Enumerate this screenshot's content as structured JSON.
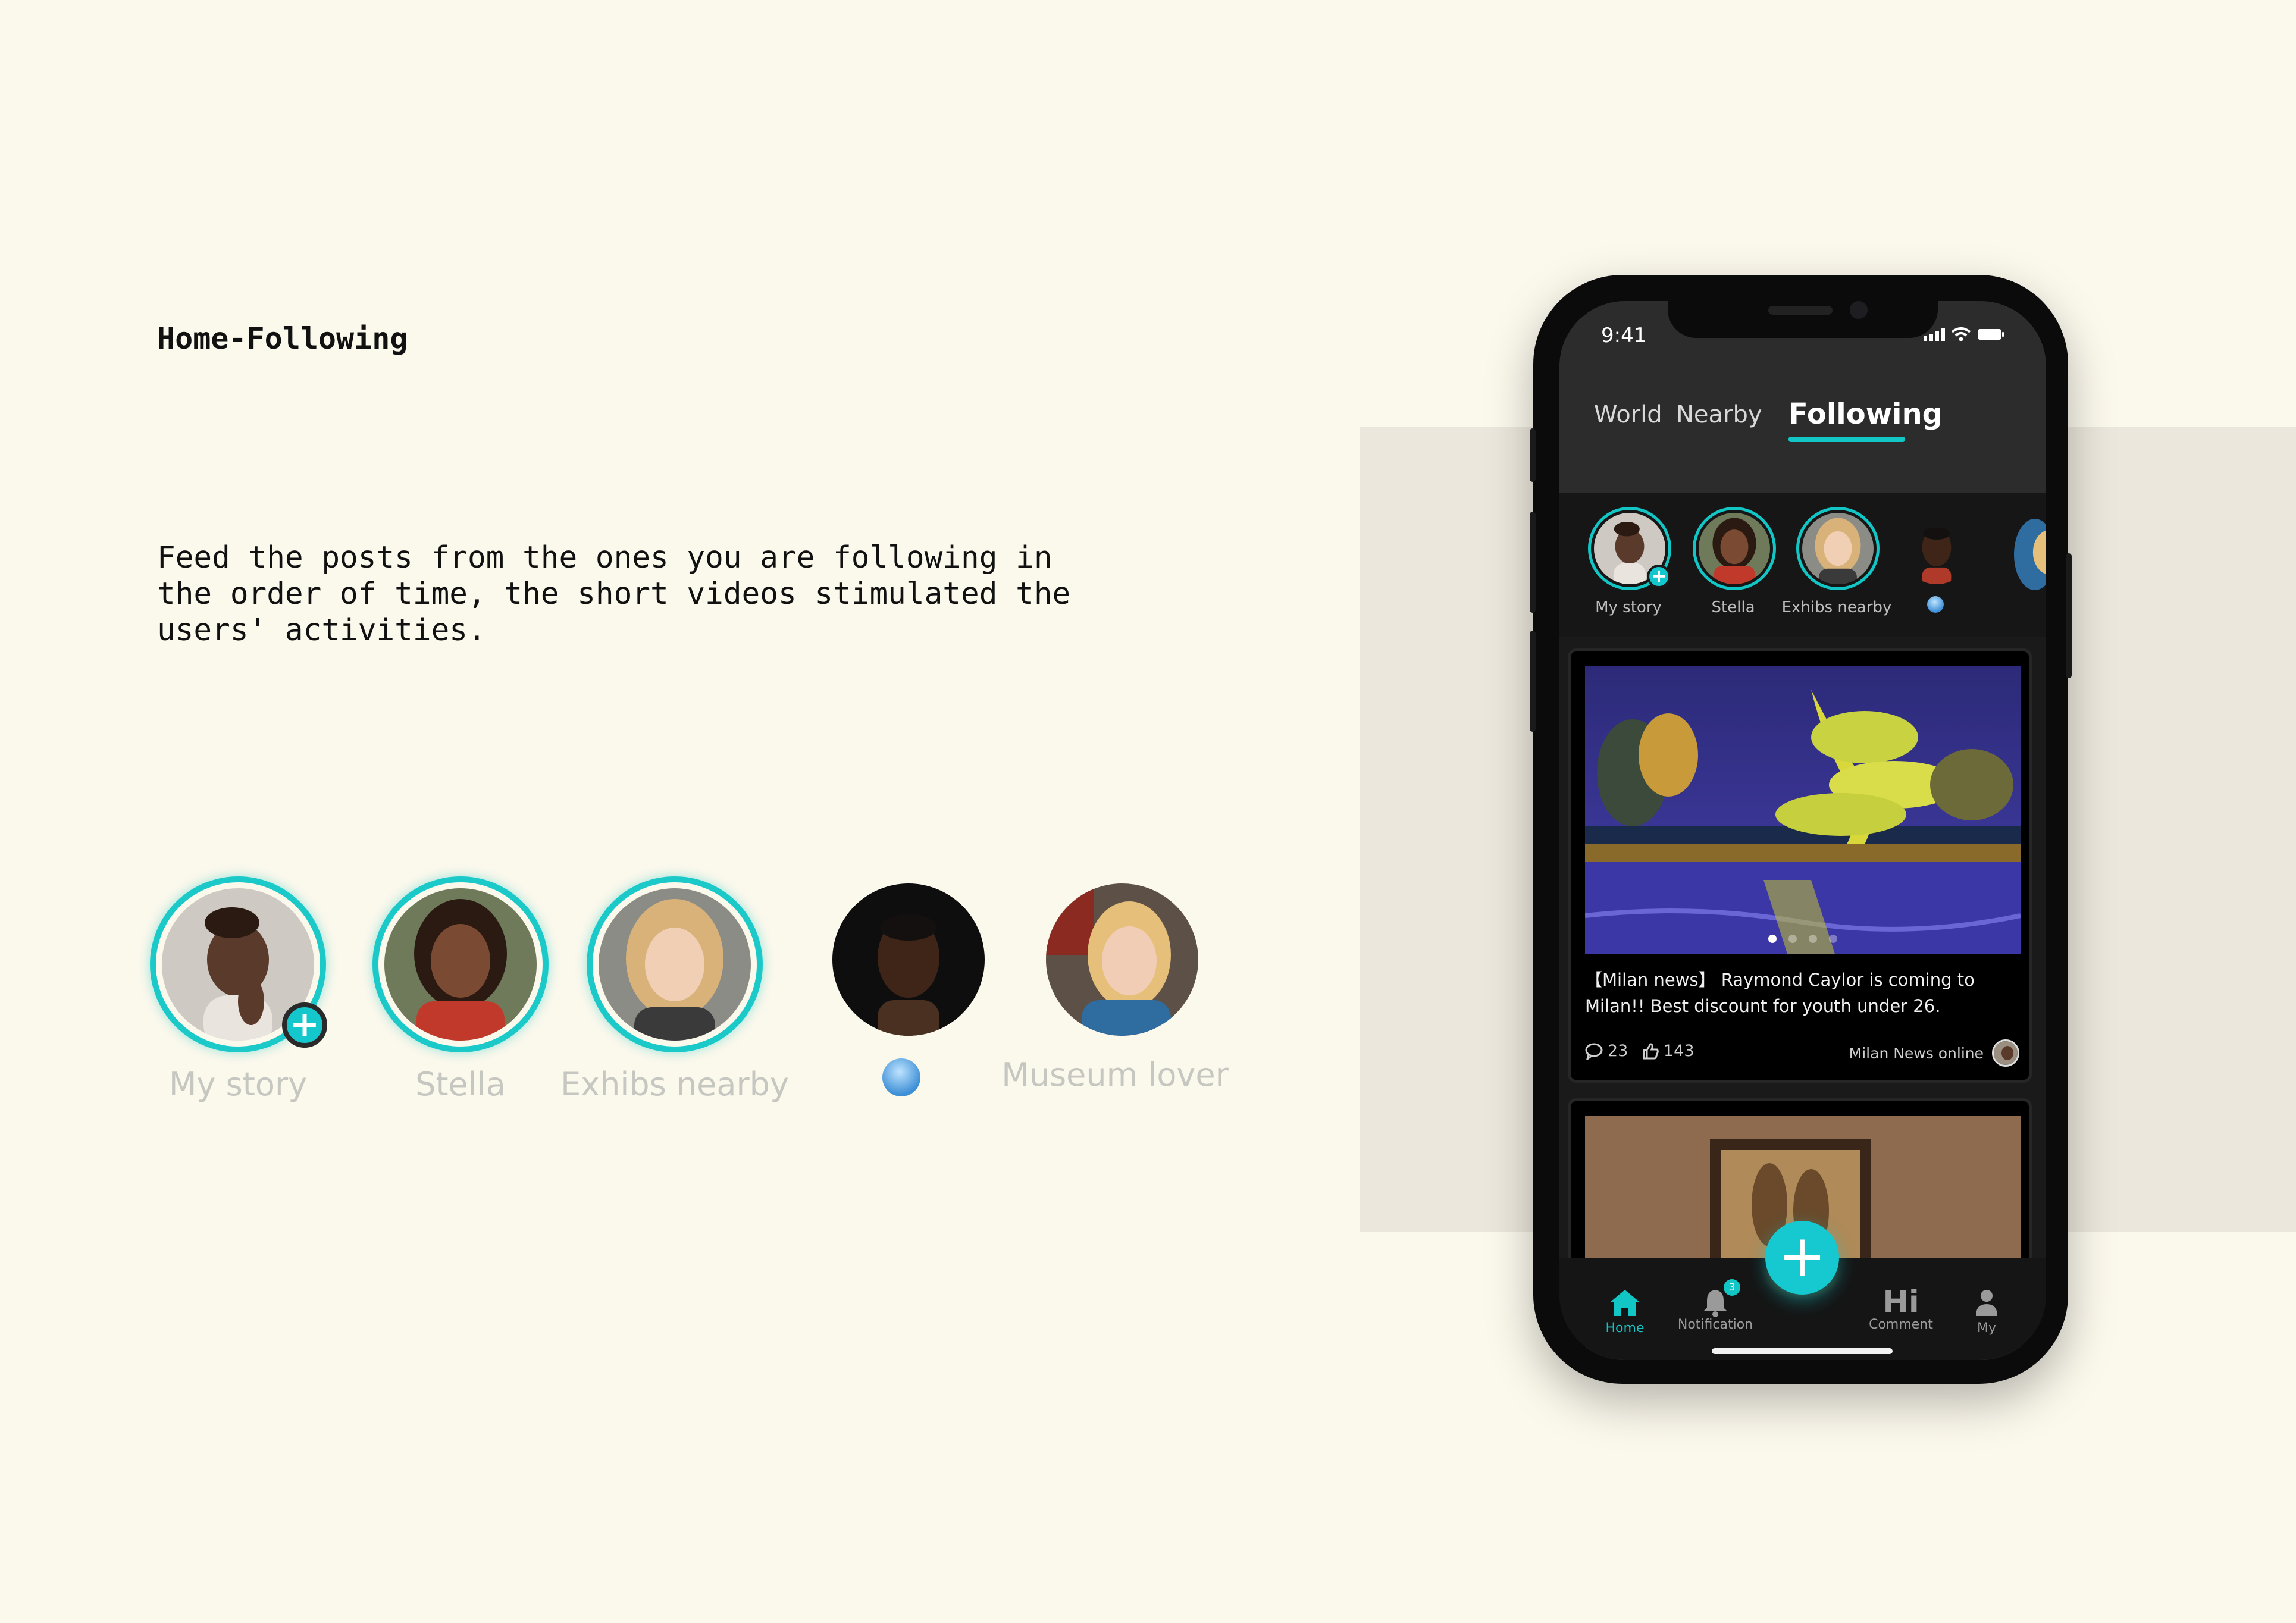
{
  "page": {
    "title": "Home-Following",
    "description": "Feed the posts from the ones you are following in\nthe order of time, the short videos stimulated the\nusers' activities."
  },
  "stories": [
    {
      "label": "My story",
      "active": true
    },
    {
      "label": "Stella",
      "active": true
    },
    {
      "label": "Exhibs nearby",
      "active": true
    },
    {
      "label": "",
      "active": false
    },
    {
      "label": "Museum lover",
      "active": false
    }
  ],
  "phone": {
    "status": {
      "time": "9:41"
    },
    "tabs": {
      "world": "World",
      "nearby": "Nearby",
      "following": "Following"
    },
    "mini_stories": [
      {
        "label": "My story"
      },
      {
        "label": "Stella"
      },
      {
        "label": "Exhibs nearby"
      },
      {
        "label": ""
      }
    ],
    "post": {
      "text": "【Milan news】 Raymond Caylor is coming to Milan!! Best discount for youth under 26.",
      "comments": "23",
      "likes": "143",
      "source": "Milan News online",
      "carousel_dots": 4,
      "carousel_active": 1
    },
    "tabbar": {
      "home": "Home",
      "notification": "Notification",
      "notification_badge": "3",
      "comment": "Comment",
      "comment_icon_text": "Hi",
      "my": "My",
      "fab": "+"
    }
  },
  "colors": {
    "accent": "#12c6c6",
    "page_background": "#fbf8ec",
    "band": "#ebe7dc",
    "phone_body": "#0b0b0b"
  }
}
